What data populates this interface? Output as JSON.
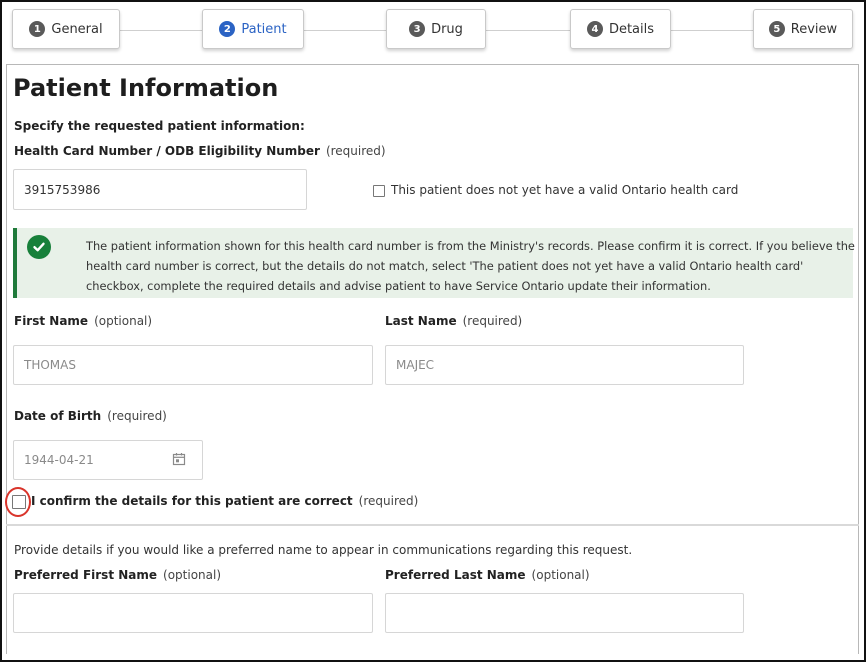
{
  "stepper": {
    "steps": [
      {
        "number": "1",
        "label": "General"
      },
      {
        "number": "2",
        "label": "Patient"
      },
      {
        "number": "3",
        "label": "Drug"
      },
      {
        "number": "4",
        "label": "Details"
      },
      {
        "number": "5",
        "label": "Review"
      }
    ],
    "active_step": "Patient"
  },
  "page": {
    "title": "Patient Information",
    "subtitle": "Specify the requested patient information:"
  },
  "health_card": {
    "label": "Health Card Number / ODB Eligibility Number",
    "hint": "(required)",
    "value": "3915753986",
    "no_card_checkbox_label": "This patient does not yet have a valid Ontario health card"
  },
  "alert": {
    "message": "The patient information shown for this health card number is from the Ministry's records. Please confirm it is correct. If you believe the health card number is correct, but the details do not match, select 'The patient does not yet have a valid Ontario health card' checkbox, complete the required details and advise patient to have Service Ontario update their information."
  },
  "first_name": {
    "label": "First Name",
    "hint": "(optional)",
    "value": "THOMAS"
  },
  "last_name": {
    "label": "Last Name",
    "hint": "(required)",
    "value": "MAJEC"
  },
  "dob": {
    "label": "Date of Birth",
    "hint": "(required)",
    "value": "1944-04-21"
  },
  "confirm": {
    "label": "I confirm the details for this patient are correct",
    "hint": "(required)"
  },
  "preferred": {
    "intro": "Provide details if you would like a preferred name to appear in communications regarding this request.",
    "first_label": "Preferred First Name",
    "first_hint": "(optional)",
    "first_value": "",
    "last_label": "Preferred Last Name",
    "last_hint": "(optional)",
    "last_value": ""
  },
  "colors": {
    "active_step": "#2b63c4",
    "success": "#17803a",
    "alert_bg": "#e8f1e8",
    "highlight": "#d9342b"
  }
}
